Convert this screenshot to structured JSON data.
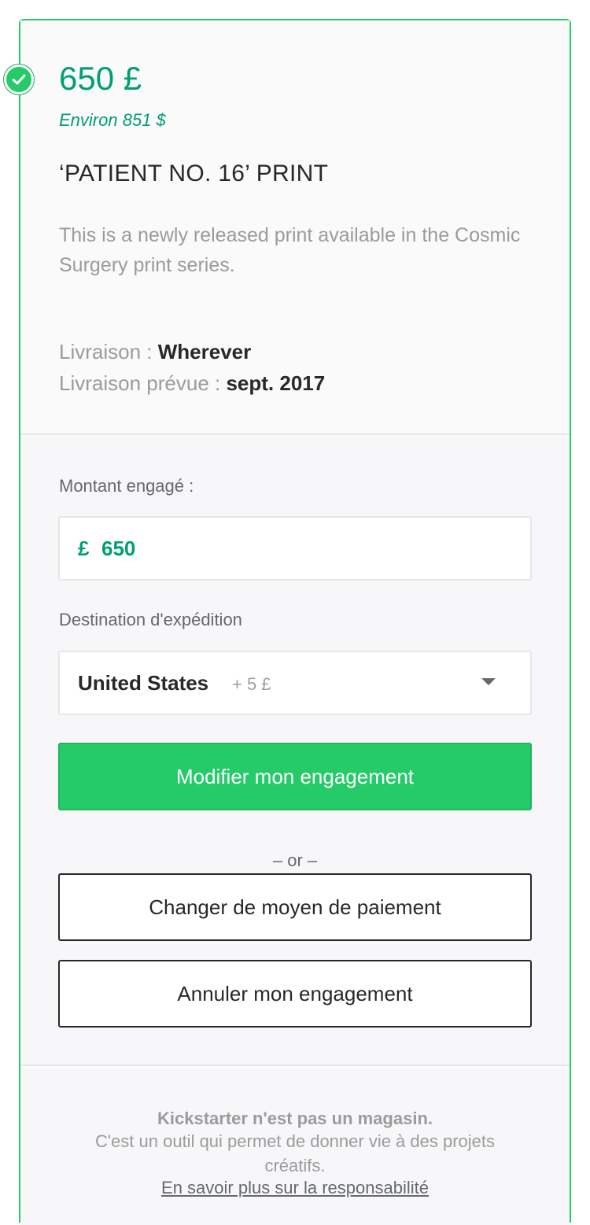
{
  "reward": {
    "price": "650 £",
    "price_approx": "Environ 851 $",
    "title": "‘PATIENT NO. 16’ PRINT",
    "description": "This is a newly released print available in the Cosmic Surgery print series.",
    "shipping_label": "Livraison :",
    "shipping_value": "Wherever",
    "delivery_label": "Livraison prévue :",
    "delivery_value": "sept. 2017",
    "selected_icon": "check-circle-icon"
  },
  "pledge_form": {
    "amount_label": "Montant engagé :",
    "currency_symbol": "£",
    "amount_value": "650",
    "destination_label": "Destination d'expédition",
    "destination_value": "United States",
    "destination_extra": "+ 5 £",
    "dropdown_icon": "caret-down-icon",
    "update_button": "Modifier mon engagement",
    "or_separator": "– or –",
    "change_payment_button": "Changer de moyen de paiement",
    "cancel_button": "Annuler mon engagement"
  },
  "footer": {
    "notice_bold": "Kickstarter n'est pas un magasin.",
    "notice_text": "C'est un outil qui permet de donner vie à des projets créatifs.",
    "learn_more_link": "En savoir plus sur la responsabilité"
  },
  "colors": {
    "accent_green": "#25cb68",
    "price_green": "#009e74",
    "text_dark": "#282828",
    "text_muted": "#9b9b9b"
  }
}
